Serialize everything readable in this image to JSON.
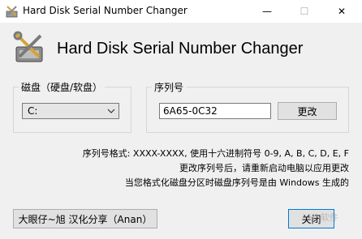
{
  "window": {
    "title": "Hard Disk Serial Number Changer",
    "min_glyph": "—",
    "max_glyph": "☐",
    "close_glyph": "✕"
  },
  "header": {
    "title": "Hard Disk Serial Number Changer",
    "icon": "tools-disk-icon"
  },
  "disk_group": {
    "label": "磁盘（硬盘/软盘）",
    "selected": "C:"
  },
  "serial_group": {
    "label": "序列号",
    "value": "6A65-0C32",
    "change_label": "更改"
  },
  "info": {
    "line1": "序列号格式: XXXX-XXXX, 使用十六进制符号 0-9, A, B, C, D, E, F",
    "line2": "更改序列号后，请重新启动电脑以应用更改",
    "line3": "当您格式化磁盘分区时磁盘序列号是由 Windows 生成的"
  },
  "footer": {
    "credit_label": "大眼仔~旭 汉化分享（Anan）",
    "close_label": "关闭"
  },
  "watermark": "Hi 软件"
}
